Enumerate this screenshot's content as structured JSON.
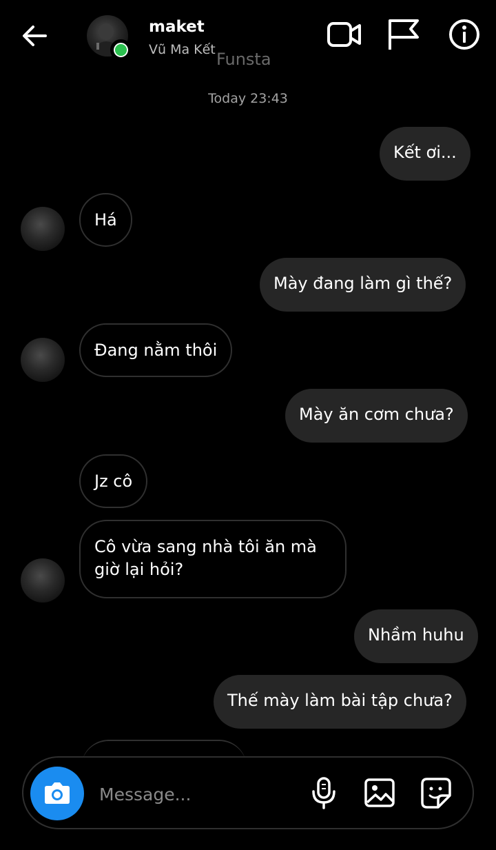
{
  "header": {
    "contact_name": "maket",
    "contact_subtitle": "Vũ Ma Kết",
    "watermark": "Funsta",
    "icons": [
      "back-arrow-icon",
      "video-call-icon",
      "flag-icon",
      "info-icon"
    ],
    "online_color": "#2bc04f"
  },
  "conversation": {
    "timestamp": "Today 23:43",
    "messages": [
      {
        "direction": "outgoing",
        "text": "Kết ơi..."
      },
      {
        "direction": "incoming",
        "text": "Há"
      },
      {
        "direction": "outgoing",
        "text": "Mày đang làm gì thế?"
      },
      {
        "direction": "incoming",
        "text": "Đang nằm thôi"
      },
      {
        "direction": "outgoing",
        "text": "Mày ăn cơm chưa?"
      },
      {
        "direction": "incoming",
        "text": "Jz cô"
      },
      {
        "direction": "incoming",
        "text": "Cô vừa sang nhà tôi ăn mà giờ lại hỏi?"
      },
      {
        "direction": "outgoing",
        "text": "Nhầm huhu"
      },
      {
        "direction": "outgoing",
        "text": "Thế mày làm bài tập chưa?"
      }
    ]
  },
  "composer": {
    "placeholder": "Message...",
    "icons": [
      "camera-icon",
      "microphone-icon",
      "gallery-icon",
      "sticker-icon"
    ],
    "camera_color": "#1a8cf0"
  }
}
